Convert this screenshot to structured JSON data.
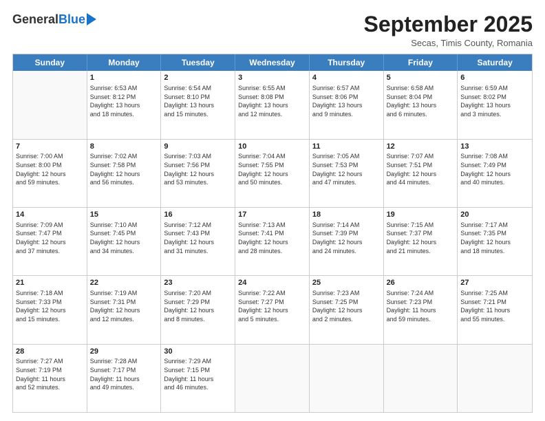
{
  "header": {
    "logo_general": "General",
    "logo_blue": "Blue",
    "month_title": "September 2025",
    "subtitle": "Secas, Timis County, Romania"
  },
  "days_of_week": [
    "Sunday",
    "Monday",
    "Tuesday",
    "Wednesday",
    "Thursday",
    "Friday",
    "Saturday"
  ],
  "weeks": [
    [
      {
        "day": "",
        "info": ""
      },
      {
        "day": "1",
        "info": "Sunrise: 6:53 AM\nSunset: 8:12 PM\nDaylight: 13 hours\nand 18 minutes."
      },
      {
        "day": "2",
        "info": "Sunrise: 6:54 AM\nSunset: 8:10 PM\nDaylight: 13 hours\nand 15 minutes."
      },
      {
        "day": "3",
        "info": "Sunrise: 6:55 AM\nSunset: 8:08 PM\nDaylight: 13 hours\nand 12 minutes."
      },
      {
        "day": "4",
        "info": "Sunrise: 6:57 AM\nSunset: 8:06 PM\nDaylight: 13 hours\nand 9 minutes."
      },
      {
        "day": "5",
        "info": "Sunrise: 6:58 AM\nSunset: 8:04 PM\nDaylight: 13 hours\nand 6 minutes."
      },
      {
        "day": "6",
        "info": "Sunrise: 6:59 AM\nSunset: 8:02 PM\nDaylight: 13 hours\nand 3 minutes."
      }
    ],
    [
      {
        "day": "7",
        "info": "Sunrise: 7:00 AM\nSunset: 8:00 PM\nDaylight: 12 hours\nand 59 minutes."
      },
      {
        "day": "8",
        "info": "Sunrise: 7:02 AM\nSunset: 7:58 PM\nDaylight: 12 hours\nand 56 minutes."
      },
      {
        "day": "9",
        "info": "Sunrise: 7:03 AM\nSunset: 7:56 PM\nDaylight: 12 hours\nand 53 minutes."
      },
      {
        "day": "10",
        "info": "Sunrise: 7:04 AM\nSunset: 7:55 PM\nDaylight: 12 hours\nand 50 minutes."
      },
      {
        "day": "11",
        "info": "Sunrise: 7:05 AM\nSunset: 7:53 PM\nDaylight: 12 hours\nand 47 minutes."
      },
      {
        "day": "12",
        "info": "Sunrise: 7:07 AM\nSunset: 7:51 PM\nDaylight: 12 hours\nand 44 minutes."
      },
      {
        "day": "13",
        "info": "Sunrise: 7:08 AM\nSunset: 7:49 PM\nDaylight: 12 hours\nand 40 minutes."
      }
    ],
    [
      {
        "day": "14",
        "info": "Sunrise: 7:09 AM\nSunset: 7:47 PM\nDaylight: 12 hours\nand 37 minutes."
      },
      {
        "day": "15",
        "info": "Sunrise: 7:10 AM\nSunset: 7:45 PM\nDaylight: 12 hours\nand 34 minutes."
      },
      {
        "day": "16",
        "info": "Sunrise: 7:12 AM\nSunset: 7:43 PM\nDaylight: 12 hours\nand 31 minutes."
      },
      {
        "day": "17",
        "info": "Sunrise: 7:13 AM\nSunset: 7:41 PM\nDaylight: 12 hours\nand 28 minutes."
      },
      {
        "day": "18",
        "info": "Sunrise: 7:14 AM\nSunset: 7:39 PM\nDaylight: 12 hours\nand 24 minutes."
      },
      {
        "day": "19",
        "info": "Sunrise: 7:15 AM\nSunset: 7:37 PM\nDaylight: 12 hours\nand 21 minutes."
      },
      {
        "day": "20",
        "info": "Sunrise: 7:17 AM\nSunset: 7:35 PM\nDaylight: 12 hours\nand 18 minutes."
      }
    ],
    [
      {
        "day": "21",
        "info": "Sunrise: 7:18 AM\nSunset: 7:33 PM\nDaylight: 12 hours\nand 15 minutes."
      },
      {
        "day": "22",
        "info": "Sunrise: 7:19 AM\nSunset: 7:31 PM\nDaylight: 12 hours\nand 12 minutes."
      },
      {
        "day": "23",
        "info": "Sunrise: 7:20 AM\nSunset: 7:29 PM\nDaylight: 12 hours\nand 8 minutes."
      },
      {
        "day": "24",
        "info": "Sunrise: 7:22 AM\nSunset: 7:27 PM\nDaylight: 12 hours\nand 5 minutes."
      },
      {
        "day": "25",
        "info": "Sunrise: 7:23 AM\nSunset: 7:25 PM\nDaylight: 12 hours\nand 2 minutes."
      },
      {
        "day": "26",
        "info": "Sunrise: 7:24 AM\nSunset: 7:23 PM\nDaylight: 11 hours\nand 59 minutes."
      },
      {
        "day": "27",
        "info": "Sunrise: 7:25 AM\nSunset: 7:21 PM\nDaylight: 11 hours\nand 55 minutes."
      }
    ],
    [
      {
        "day": "28",
        "info": "Sunrise: 7:27 AM\nSunset: 7:19 PM\nDaylight: 11 hours\nand 52 minutes."
      },
      {
        "day": "29",
        "info": "Sunrise: 7:28 AM\nSunset: 7:17 PM\nDaylight: 11 hours\nand 49 minutes."
      },
      {
        "day": "30",
        "info": "Sunrise: 7:29 AM\nSunset: 7:15 PM\nDaylight: 11 hours\nand 46 minutes."
      },
      {
        "day": "",
        "info": ""
      },
      {
        "day": "",
        "info": ""
      },
      {
        "day": "",
        "info": ""
      },
      {
        "day": "",
        "info": ""
      }
    ]
  ]
}
